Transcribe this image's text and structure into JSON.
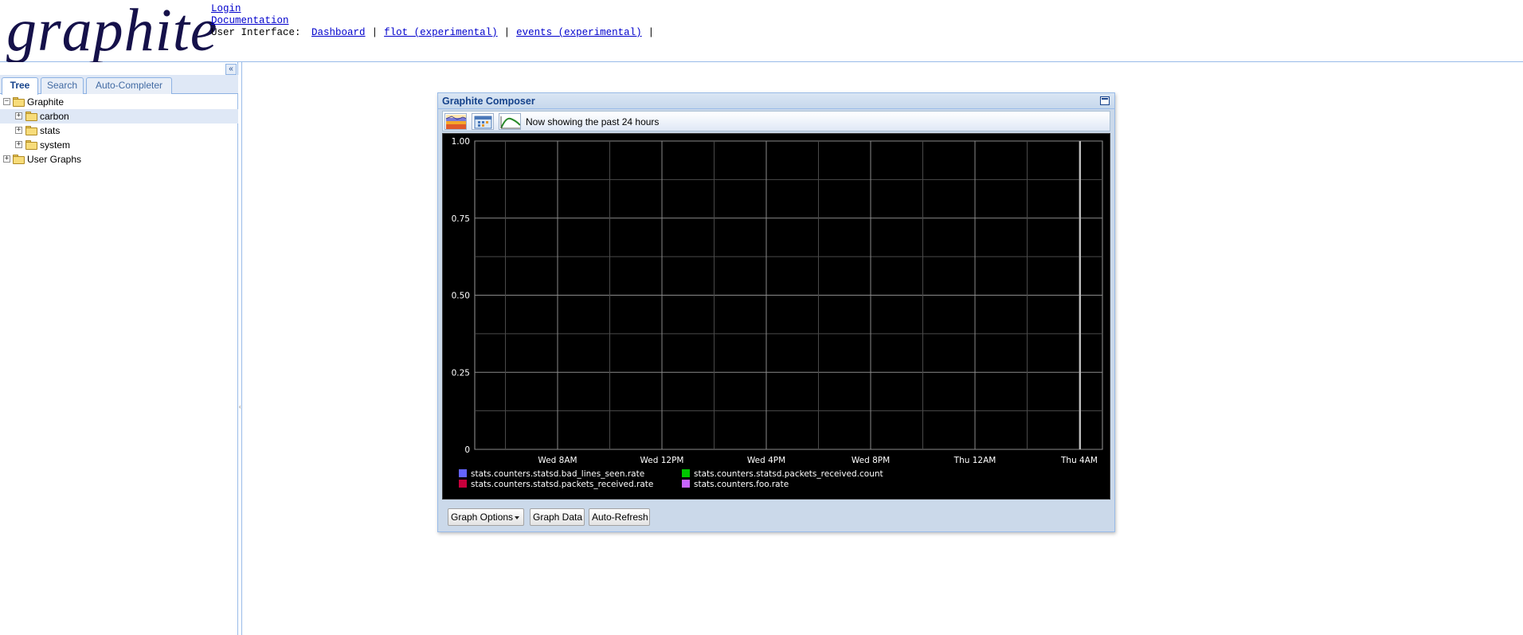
{
  "header": {
    "logo": "graphite",
    "login": "Login",
    "documentation": "Documentation",
    "ui_label": "User Interface:",
    "links": [
      "Dashboard",
      "flot (experimental)",
      "events (experimental)"
    ],
    "separator": "|"
  },
  "left_panel": {
    "collapse_glyph": "«",
    "tabs": [
      {
        "label": "Tree",
        "active": true
      },
      {
        "label": "Search",
        "active": false
      },
      {
        "label": "Auto-Completer",
        "active": false
      }
    ],
    "tree": [
      {
        "label": "Graphite",
        "expanded": true,
        "level": 0,
        "highlight": false
      },
      {
        "label": "carbon",
        "expanded": false,
        "level": 1,
        "highlight": true
      },
      {
        "label": "stats",
        "expanded": false,
        "level": 1,
        "highlight": false
      },
      {
        "label": "system",
        "expanded": false,
        "level": 1,
        "highlight": false
      },
      {
        "label": "User Graphs",
        "expanded": false,
        "level": 0,
        "highlight": false
      }
    ]
  },
  "composer": {
    "title": "Graphite Composer",
    "status": "Now showing the past 24 hours",
    "toolbar_icons": [
      "dashboard-icon",
      "select-date-range-icon",
      "recent-data-icon"
    ],
    "buttons": {
      "graph_options": "Graph Options",
      "graph_data": "Graph Data",
      "auto_refresh": "Auto-Refresh"
    }
  },
  "chart_data": {
    "type": "line",
    "background": "#000000",
    "grid": true,
    "grid_color": "#555555",
    "yticks": [
      {
        "value": 0,
        "label": "0"
      },
      {
        "value": 0.25,
        "label": "0.25"
      },
      {
        "value": 0.5,
        "label": "0.50"
      },
      {
        "value": 0.75,
        "label": "0.75"
      },
      {
        "value": 1.0,
        "label": "1.00"
      }
    ],
    "ylim": [
      0,
      1
    ],
    "xticks": [
      "Wed  8AM",
      "Wed 12PM",
      "Wed  4PM",
      "Wed  8PM",
      "Thu 12AM",
      "Thu  4AM"
    ],
    "series": [
      {
        "name": "stats.counters.statsd.bad_lines_seen.rate",
        "color": "#6464ff",
        "values": []
      },
      {
        "name": "stats.counters.statsd.packets_received.count",
        "color": "#00c800",
        "values": []
      },
      {
        "name": "stats.counters.statsd.packets_received.rate",
        "color": "#c8003c",
        "values": []
      },
      {
        "name": "stats.counters.foo.rate",
        "color": "#c864ff",
        "values": []
      }
    ],
    "legend_placement": "bottom"
  }
}
